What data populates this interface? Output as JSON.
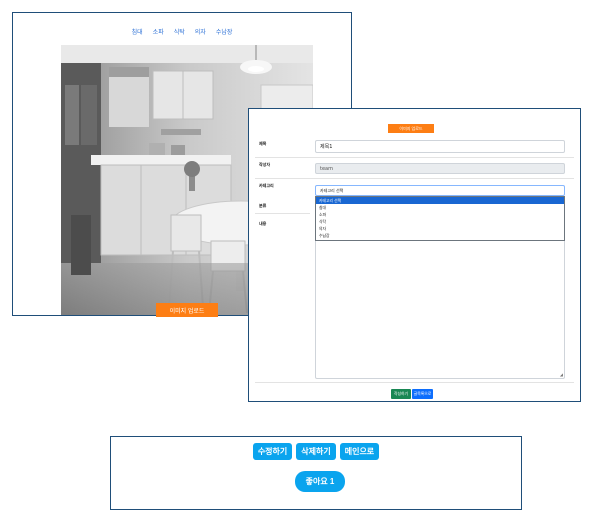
{
  "gallery": {
    "categories": [
      "침대",
      "소파",
      "식탁",
      "의자",
      "수납장"
    ],
    "upload_label": "이미지 업로드",
    "photo_alt": "kitchen-photo"
  },
  "edit_form": {
    "upload_label": "이미지 업로드",
    "labels": {
      "title": "제목",
      "author": "작성자",
      "category": "카테고리",
      "type": "분류",
      "content": "내용"
    },
    "values": {
      "title": "제목1",
      "author": "team",
      "category_placeholder": "카테고리 선택"
    },
    "dropdown_options": [
      "카테고리 선택",
      "침대",
      "소파",
      "식탁",
      "의자",
      "수납장"
    ],
    "dropdown_selected_index": 0,
    "buttons": {
      "save": "작성하기",
      "back": "글목록으로"
    }
  },
  "actions": {
    "edit": "수정하기",
    "delete": "삭제하기",
    "main": "메인으로",
    "like": "좋아요 1"
  },
  "colors": {
    "orange": "#fd7e14",
    "accent_blue": "#0aa4ee",
    "link_blue": "#2a6fd6",
    "border": "#1f4e79",
    "green": "#198754",
    "primary": "#0d6efd"
  }
}
